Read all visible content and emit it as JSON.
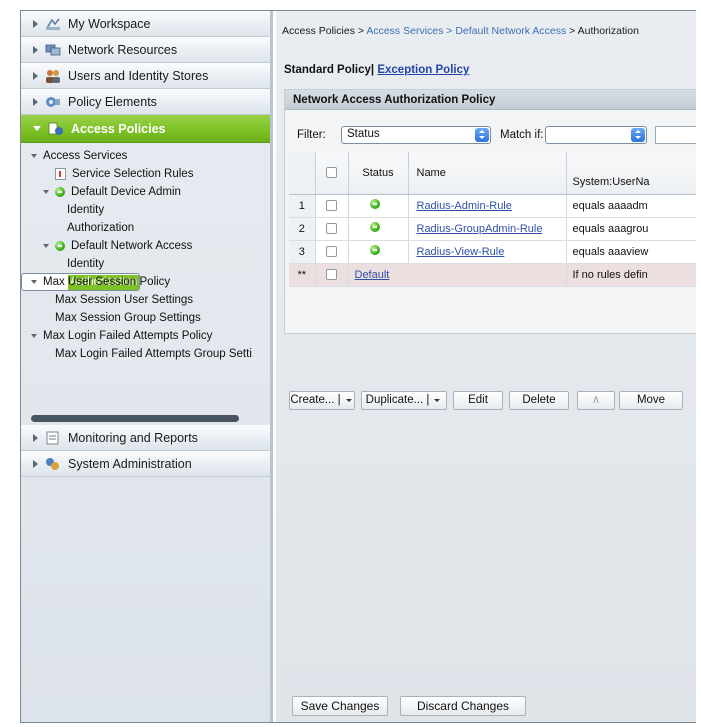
{
  "nav": {
    "drawers_top": [
      {
        "label": "My Workspace",
        "icon": "workspace-icon"
      },
      {
        "label": "Network Resources",
        "icon": "network-resources-icon"
      },
      {
        "label": "Users and Identity Stores",
        "icon": "users-icon"
      },
      {
        "label": "Policy Elements",
        "icon": "policy-elements-icon"
      },
      {
        "label": "Access Policies",
        "icon": "access-policies-icon",
        "active": true
      }
    ],
    "tree": [
      {
        "label": "Access Services",
        "level": 0
      },
      {
        "label": "Service Selection Rules",
        "level": 1
      },
      {
        "label": "Default Device Admin",
        "level": 1
      },
      {
        "label": "Identity",
        "level": 2
      },
      {
        "label": "Authorization",
        "level": 2
      },
      {
        "label": "Default Network Access",
        "level": 1
      },
      {
        "label": "Identity",
        "level": 2
      },
      {
        "label": "Authorization",
        "level": 2,
        "selected": true
      },
      {
        "label": "Max User Session Policy",
        "level": 0
      },
      {
        "label": "Max Session User Settings",
        "level": 1
      },
      {
        "label": "Max Session Group Settings",
        "level": 1
      },
      {
        "label": "Max Login Failed Attempts Policy",
        "level": 0
      },
      {
        "label": "Max Login Failed Attempts Group Setti",
        "level": 1
      }
    ],
    "drawers_bottom": [
      {
        "label": "Monitoring and Reports",
        "icon": "monitoring-icon"
      },
      {
        "label": "System Administration",
        "icon": "system-admin-icon"
      }
    ]
  },
  "breadcrumb": {
    "part1": "Access Policies >",
    "part2": "Access Services >",
    "part3": "Default Network Access",
    "part4": "> Authorization"
  },
  "policy_tabs": {
    "standard": "Standard Policy|",
    "exception": "Exception Policy"
  },
  "panel": {
    "title": "Network Access Authorization Policy",
    "filter_label": "Filter:",
    "filter_value": "Status",
    "match_label": "Match if:",
    "match_value": ""
  },
  "table": {
    "headers": {
      "status": "Status",
      "name": "Name",
      "condition": "System:UserNa"
    },
    "rows": [
      {
        "num": "1",
        "name": "Radius-Admin-Rule",
        "condition": "equals aaaadm"
      },
      {
        "num": "2",
        "name": "Radius-GroupAdmin-Rule",
        "condition": "equals aaagrou"
      },
      {
        "num": "3",
        "name": "Radius-View-Rule",
        "condition": "equals aaaview"
      }
    ],
    "default_row": {
      "num": "**",
      "name": "Default",
      "condition": "If no rules defin"
    }
  },
  "actions": {
    "create": "Create... |",
    "duplicate": "Duplicate... |",
    "edit": "Edit",
    "delete": "Delete",
    "up": "∧",
    "move": "Move"
  },
  "footer": {
    "save": "Save Changes",
    "discard": "Discard Changes"
  },
  "colors": {
    "active_drawer": "#7ec227",
    "link": "#2f4fa8",
    "status_enabled": "#3fb81f"
  }
}
